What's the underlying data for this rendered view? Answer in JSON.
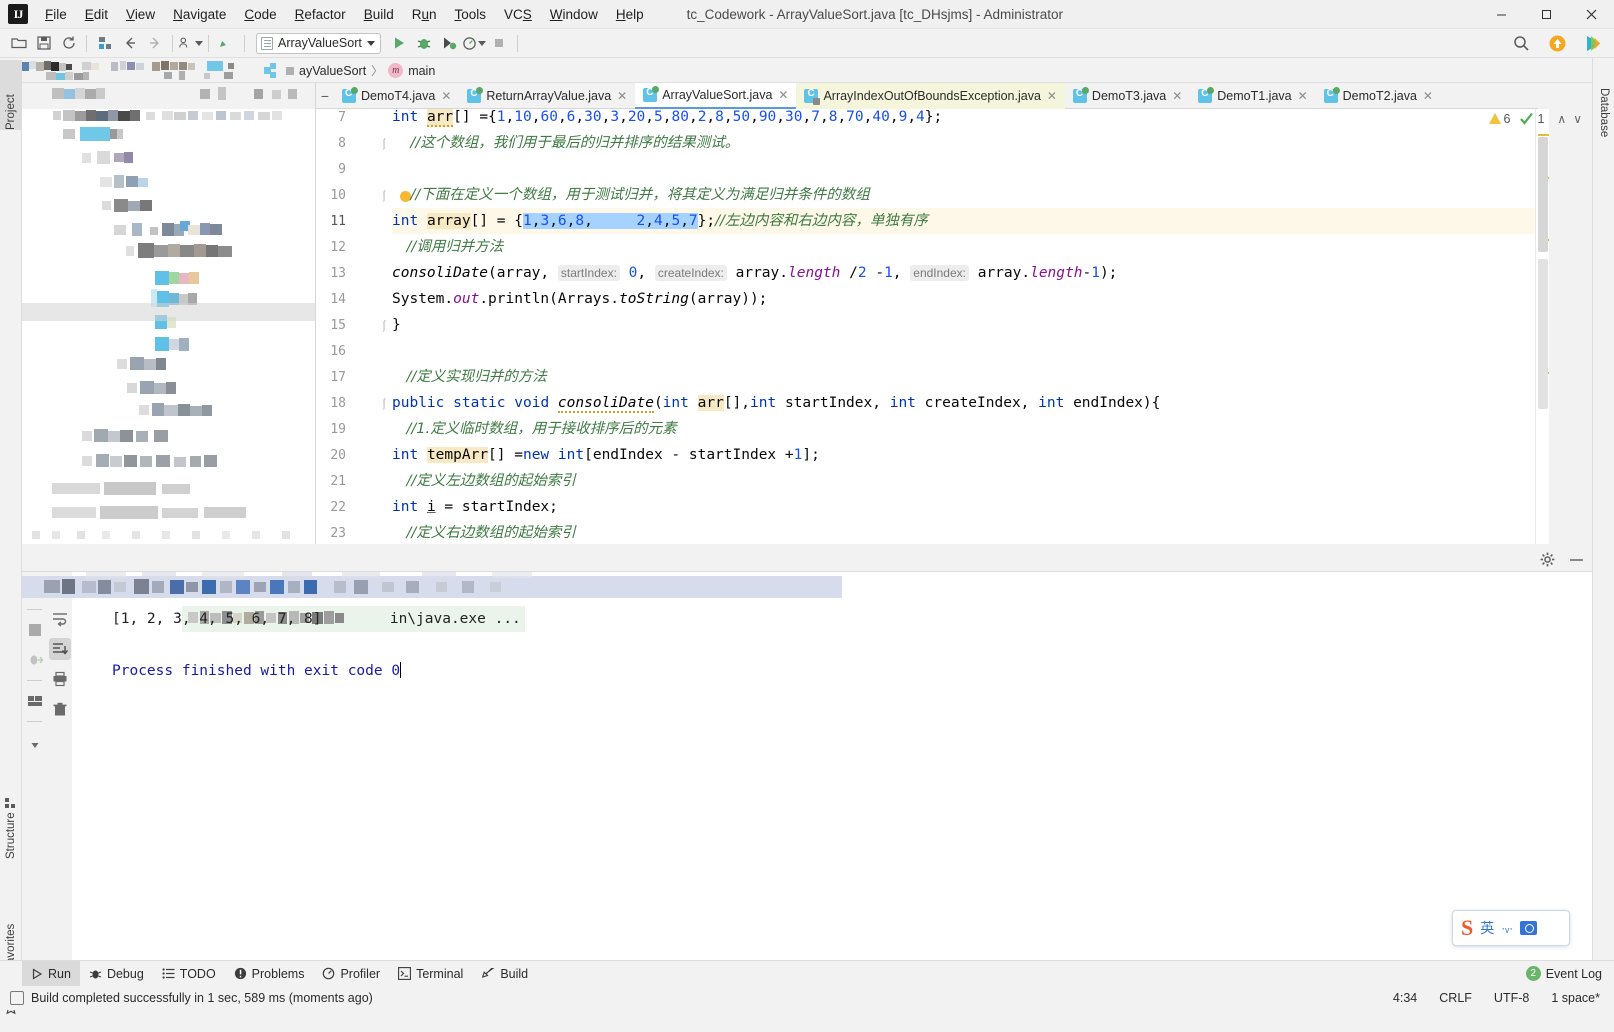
{
  "window": {
    "title": "tc_Codework - ArrayValueSort.java [tc_DHsjms] - Administrator",
    "minimize_label": "─",
    "maximize_label": "☐",
    "close_label": "✕"
  },
  "menu": [
    {
      "label": "File"
    },
    {
      "label": "Edit"
    },
    {
      "label": "View"
    },
    {
      "label": "Navigate"
    },
    {
      "label": "Code"
    },
    {
      "label": "Refactor"
    },
    {
      "label": "Build"
    },
    {
      "label": "Run"
    },
    {
      "label": "Tools"
    },
    {
      "label": "VCS"
    },
    {
      "label": "Window"
    },
    {
      "label": "Help"
    }
  ],
  "toolbar": {
    "run_config": "ArrayValueSort",
    "icons": [
      "open-folder-icon",
      "save-icon",
      "sync-icon",
      "project-structure-icon",
      "back-arrow-icon",
      "forward-arrow-icon",
      "profile-icon",
      "build-hammer-icon"
    ],
    "run_icon": "run-icon",
    "debug_icon": "debug-icon",
    "run-coverage_icon": "run-with-coverage-icon",
    "profile_icon": "profiler-icon",
    "stop_icon": "stop-icon",
    "search_icon": "search-icon",
    "update_icon": "update-icon",
    "ide_icon": "ide-icon"
  },
  "breadcrumb": {
    "file": "ayValueSort",
    "separator": "〉",
    "member_icon": "m",
    "member": "main"
  },
  "left_strip": {
    "project_label": "Project",
    "structure_label": "Structure",
    "favorites_label": "Favorites"
  },
  "right_strip": {
    "database_label": "Database"
  },
  "editor_tabs": [
    {
      "label": "DemoT4.java",
      "icon": "java-class-runnable-icon",
      "active": false,
      "modified": false,
      "close": "✕"
    },
    {
      "label": "ReturnArrayValue.java",
      "icon": "java-class-runnable-icon",
      "active": false,
      "modified": false,
      "close": "✕"
    },
    {
      "label": "ArrayValueSort.java",
      "icon": "java-class-runnable-icon",
      "active": true,
      "modified": false,
      "close": "✕"
    },
    {
      "label": "ArrayIndexOutOfBoundsException.java",
      "icon": "java-class-locked-icon",
      "active": false,
      "modified": true,
      "close": "✕"
    },
    {
      "label": "DemoT3.java",
      "icon": "java-class-runnable-icon",
      "active": false,
      "modified": false,
      "close": "✕"
    },
    {
      "label": "DemoT1.java",
      "icon": "java-class-runnable-icon",
      "active": false,
      "modified": false,
      "close": "✕"
    },
    {
      "label": "DemoT2.java",
      "icon": "java-class-runnable-icon",
      "active": false,
      "modified": false,
      "close": "✕"
    }
  ],
  "inspections": {
    "warning_count": "6",
    "check_count": "1",
    "up_chevron": "∧",
    "down_chevron": "∨"
  },
  "editor": {
    "line_numbers": [
      "7",
      "8",
      "9",
      "10",
      "11",
      "12",
      "13",
      "14",
      "15",
      "16",
      "17",
      "18",
      "19",
      "20",
      "21",
      "22",
      "23"
    ],
    "lines": [
      {
        "n": "7",
        "text": "    int arr[] ={1,10,60,6,30,3,20,5,80,2,8,50,90,30,7,8,70,40,9,4};"
      },
      {
        "n": "8",
        "text": "    //这个数组，我们用于最后的归并排序的结果测试。"
      },
      {
        "n": "9",
        "text": ""
      },
      {
        "n": "10",
        "text": "    //下面在定义一个数组，用于测试归并，将其定义为满足归并条件的数组"
      },
      {
        "n": "11",
        "text": "    int array[] = {1,3,6,8,     2,4,5,7};//左边内容和右边内容，单独有序"
      },
      {
        "n": "12",
        "text": "    //调用归并方法"
      },
      {
        "n": "13",
        "text": "    consoliDate(array, startIndex: 0, createIndex: array.length /2 -1, endIndex: array.length-1);"
      },
      {
        "n": "14",
        "text": "    System.out.println(Arrays.toString(array));"
      },
      {
        "n": "15",
        "text": "  }"
      },
      {
        "n": "16",
        "text": ""
      },
      {
        "n": "17",
        "text": "  //定义实现归并的方法"
      },
      {
        "n": "18",
        "text": "  public static void consoliDate(int arr[],int startIndex, int createIndex, int endIndex){"
      },
      {
        "n": "19",
        "text": "    //1.定义临时数组，用于接收排序后的元素"
      },
      {
        "n": "20",
        "text": "    int tempArr[] =new int[endIndex - startIndex +1];"
      },
      {
        "n": "21",
        "text": "    //定义左边数组的起始索引"
      },
      {
        "n": "22",
        "text": "    int i = startIndex;"
      },
      {
        "n": "23",
        "text": "    //定义右边数组的起始索引"
      }
    ],
    "param_hints": {
      "startIndex": "startIndex:",
      "createIndex": "createIndex:",
      "endIndex": "endIndex:"
    },
    "highlighted_line": "11",
    "selection": "1,3,6,8,     2,4,5,7"
  },
  "console": {
    "cmd_line": "in\\java.exe ...",
    "output_line": "[1, 2, 3, 4, 5, 6, 7, 8]",
    "exit_line": "Process finished with exit code 0",
    "settings_icon": "gear-icon",
    "minimize_icon": "minimize-icon",
    "side_icons": [
      "wrench-icon",
      "stop-icon",
      "rerun-failed-icon",
      "layout-icon",
      "pin-icon",
      "scroll-down-icon",
      "soft-wrap-icon",
      "scroll-to-end-icon",
      "print-icon",
      "trash-icon"
    ]
  },
  "bottom_bar": {
    "items": [
      {
        "label": "Run",
        "icon": "run-icon",
        "active": true
      },
      {
        "label": "Debug",
        "icon": "debug-icon",
        "active": false
      },
      {
        "label": "TODO",
        "icon": "todo-icon",
        "active": false
      },
      {
        "label": "Problems",
        "icon": "problems-icon",
        "active": false
      },
      {
        "label": "Profiler",
        "icon": "profiler-icon",
        "active": false
      },
      {
        "label": "Terminal",
        "icon": "terminal-icon",
        "active": false
      },
      {
        "label": "Build",
        "icon": "build-icon",
        "active": false
      }
    ],
    "event_log": "Event Log",
    "event_count": "2"
  },
  "statusbar": {
    "message": "Build completed successfully in 1 sec, 589 ms (moments ago)",
    "caret_position": "4:34",
    "line_separator": "CRLF",
    "encoding": "UTF-8",
    "indent": "1 space*"
  },
  "ime": {
    "logo": "S",
    "lang": "英",
    "dots": "·ᵥ·",
    "camera_icon": "camera-icon"
  },
  "colors": {
    "accent_blue": "#1750eb",
    "keyword_blue": "#0033b3",
    "comment_green": "#3e7a42",
    "selection_blue": "#a6d2ff",
    "highlight_yellow": "#fdf8e8",
    "warning_yellow": "#f0c33c",
    "run_green": "#59a869",
    "modified_tab": "#f5f5dc"
  }
}
